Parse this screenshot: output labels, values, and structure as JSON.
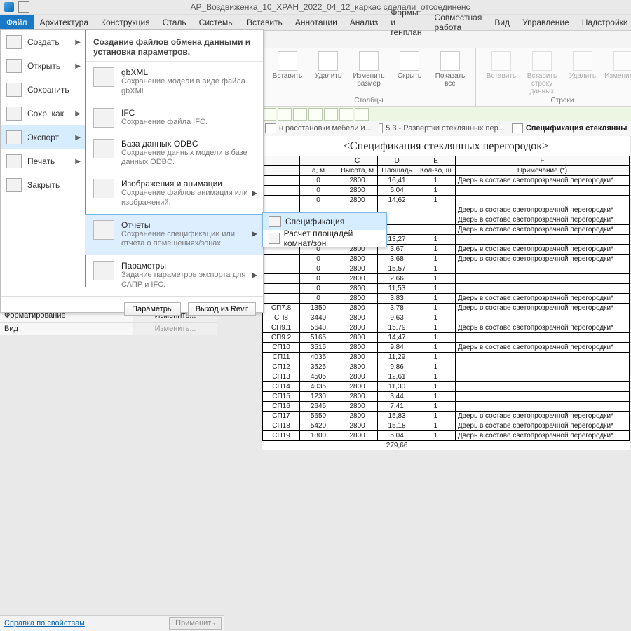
{
  "title": "АР_Воздвиженка_10_ХРАН_2022_04_12_каркас сделали_отсоединенс",
  "menubar": [
    "Файл",
    "Архитектура",
    "Конструкция",
    "Сталь",
    "Системы",
    "Вставить",
    "Аннотации",
    "Анализ",
    "Формы и генплан",
    "Совместная работа",
    "Вид",
    "Управление",
    "Надстройки"
  ],
  "ribbon": {
    "group_columns": "Столбцы",
    "group_rows": "Строки",
    "btns1": [
      {
        "l": "Вставить"
      },
      {
        "l": "Удалить"
      },
      {
        "l": "Изменить размер"
      },
      {
        "l": "Скрыть"
      },
      {
        "l": "Показать все"
      }
    ],
    "btns2": [
      {
        "l": "Вставить"
      },
      {
        "l": "Вставить строку данных"
      },
      {
        "l": "Удалить"
      },
      {
        "l": "Изменить р"
      }
    ]
  },
  "doctabs": [
    {
      "l": "н расстановки мебели и..."
    },
    {
      "l": "5.3 - Развертки стеклянных пер..."
    },
    {
      "l": "Спецификация стеклянны",
      "active": true
    }
  ],
  "properties": {
    "rows": [
      {
        "l": "Форматирование",
        "v": "Изменить..."
      },
      {
        "l": "Вид",
        "v": "Изменить...",
        "dis": true
      }
    ],
    "help": "Справка по свойствам",
    "apply": "Применить"
  },
  "file_menu": {
    "left": [
      {
        "l": "Создать",
        "arrow": true
      },
      {
        "l": "Открыть",
        "arrow": true
      },
      {
        "l": "Сохранить"
      },
      {
        "l": "Сохр. как",
        "arrow": true
      },
      {
        "l": "Экспорт",
        "arrow": true,
        "sel": true
      },
      {
        "l": "Печать",
        "arrow": true
      },
      {
        "l": "Закрыть"
      }
    ],
    "head": "Создание файлов обмена данными и установка параметров.",
    "right": [
      {
        "t": "gbXML",
        "d": "Сохранение модели в виде файла gbXML."
      },
      {
        "t": "IFC",
        "d": "Сохранение файла IFC."
      },
      {
        "t": "База данных ODBC",
        "d": "Сохранение данных модели в базе данных ODBC."
      },
      {
        "t": "Изображения и анимации",
        "d": "Сохранение файлов анимации или изображений.",
        "arrow": true
      },
      {
        "t": "Отчеты",
        "d": "Сохранение спецификации или отчета о помещениях/зонах.",
        "arrow": true,
        "hover": true
      },
      {
        "t": "Параметры",
        "d": "Задание параметров экспорта для САПР и IFC.",
        "arrow": true
      }
    ],
    "foot": {
      "options": "Параметры",
      "exit": "Выход из Revit"
    }
  },
  "flyout": [
    {
      "l": "Спецификация",
      "sel": true
    },
    {
      "l": "Расчет площадей комнат/зон"
    }
  ],
  "schedule": {
    "title": "<Спецификация стеклянных перегородок>",
    "colletters": [
      "C",
      "D",
      "E",
      "F"
    ],
    "headers": [
      "а, м",
      "Высота, м",
      "Площадь",
      "Кол-во, ш",
      "Примечание (*)"
    ],
    "total": "279,66",
    "rows": [
      {
        "a": "",
        "b": "0",
        "c": "2800",
        "d": "16,41",
        "e": "1",
        "f": "Дверь в составе светопрозрачной перегородки*"
      },
      {
        "a": "",
        "b": "0",
        "c": "2800",
        "d": "6,04",
        "e": "1",
        "f": ""
      },
      {
        "a": "",
        "b": "0",
        "c": "2800",
        "d": "14,62",
        "e": "1",
        "f": ""
      },
      {
        "a": "",
        "b": "",
        "c": "",
        "d": "",
        "e": "",
        "f": "Дверь в составе светопрозрачной перегородки*"
      },
      {
        "a": "",
        "b": "",
        "c": "",
        "d": "",
        "e": "",
        "f": "Дверь в составе светопрозрачной перегородки*"
      },
      {
        "a": "",
        "b": "",
        "c": "",
        "d": "",
        "e": "",
        "f": "Дверь в составе светопрозрачной перегородки*"
      },
      {
        "a": "",
        "b": "0",
        "c": "2800",
        "d": "13,27",
        "e": "1",
        "f": ""
      },
      {
        "a": "",
        "b": "0",
        "c": "2800",
        "d": "3,67",
        "e": "1",
        "f": "Дверь в составе светопрозрачной перегородки*"
      },
      {
        "a": "",
        "b": "0",
        "c": "2800",
        "d": "3,68",
        "e": "1",
        "f": "Дверь в составе светопрозрачной перегородки*"
      },
      {
        "a": "",
        "b": "0",
        "c": "2800",
        "d": "15,57",
        "e": "1",
        "f": ""
      },
      {
        "a": "",
        "b": "0",
        "c": "2800",
        "d": "2,66",
        "e": "1",
        "f": ""
      },
      {
        "a": "",
        "b": "0",
        "c": "2800",
        "d": "11,53",
        "e": "1",
        "f": ""
      },
      {
        "a": "",
        "b": "0",
        "c": "2800",
        "d": "3,83",
        "e": "1",
        "f": "Дверь в составе светопрозрачной перегородки*"
      },
      {
        "a": "СП7.8",
        "b": "1350",
        "c": "2800",
        "d": "3,78",
        "e": "1",
        "f": "Дверь в составе светопрозрачной перегородки*"
      },
      {
        "a": "СП8",
        "b": "3440",
        "c": "2800",
        "d": "9,63",
        "e": "1",
        "f": ""
      },
      {
        "a": "СП9.1",
        "b": "5640",
        "c": "2800",
        "d": "15,79",
        "e": "1",
        "f": "Дверь в составе светопрозрачной перегородки*"
      },
      {
        "a": "СП9.2",
        "b": "5165",
        "c": "2800",
        "d": "14,47",
        "e": "1",
        "f": ""
      },
      {
        "a": "СП10",
        "b": "3515",
        "c": "2800",
        "d": "9,84",
        "e": "1",
        "f": "Дверь в составе светопрозрачной перегородки*"
      },
      {
        "a": "СП11",
        "b": "4035",
        "c": "2800",
        "d": "11,29",
        "e": "1",
        "f": ""
      },
      {
        "a": "СП12",
        "b": "3525",
        "c": "2800",
        "d": "9,86",
        "e": "1",
        "f": ""
      },
      {
        "a": "СП13",
        "b": "4505",
        "c": "2800",
        "d": "12,61",
        "e": "1",
        "f": ""
      },
      {
        "a": "СП14",
        "b": "4035",
        "c": "2800",
        "d": "11,30",
        "e": "1",
        "f": ""
      },
      {
        "a": "СП15",
        "b": "1230",
        "c": "2800",
        "d": "3,44",
        "e": "1",
        "f": ""
      },
      {
        "a": "СП16",
        "b": "2645",
        "c": "2800",
        "d": "7,41",
        "e": "1",
        "f": ""
      },
      {
        "a": "СП17",
        "b": "5650",
        "c": "2800",
        "d": "15,83",
        "e": "1",
        "f": "Дверь в составе светопрозрачной перегородки*"
      },
      {
        "a": "СП18",
        "b": "5420",
        "c": "2800",
        "d": "15,18",
        "e": "1",
        "f": "Дверь в составе светопрозрачной перегородки*"
      },
      {
        "a": "СП19",
        "b": "1800",
        "c": "2800",
        "d": "5,04",
        "e": "1",
        "f": "Дверь в составе светопрозрачной перегородки*"
      }
    ]
  }
}
